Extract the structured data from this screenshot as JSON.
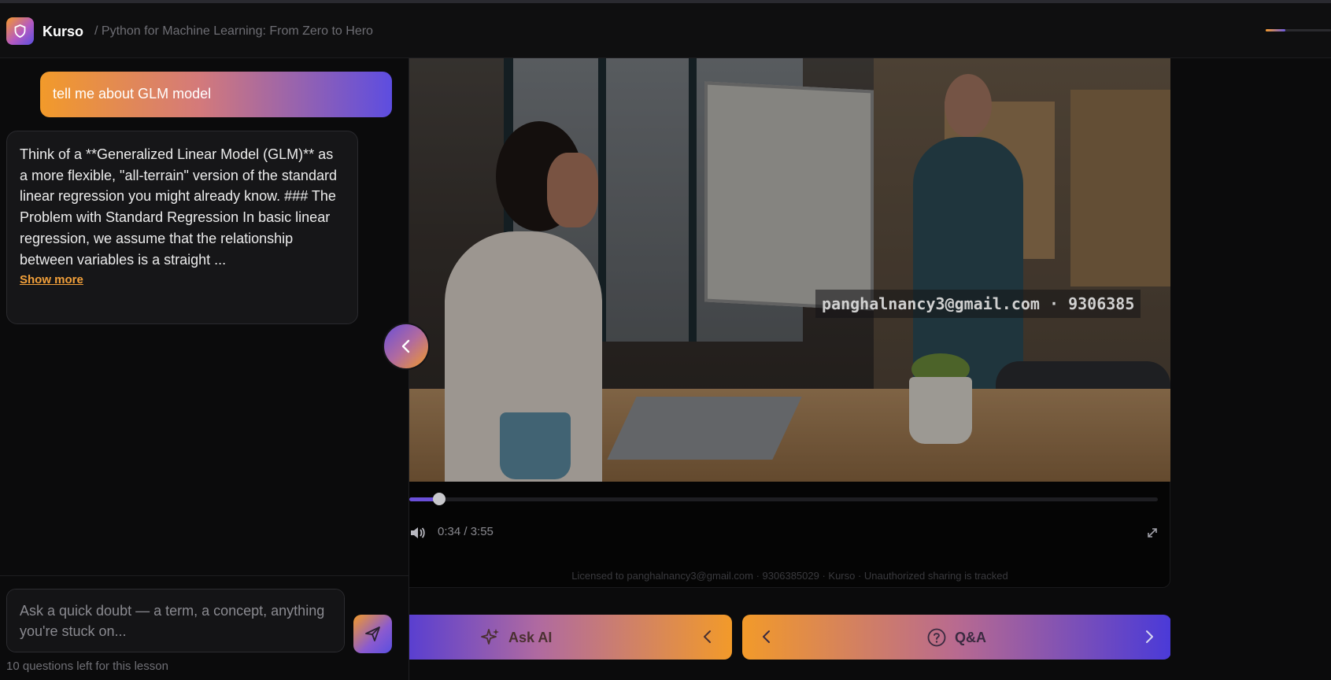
{
  "header": {
    "brand": "Kurso",
    "breadcrumb": "/ Python for Machine Learning: From Zero to Hero",
    "progress_fraction": 0.3
  },
  "chat": {
    "user_message": "tell me about GLM model",
    "ai_message": "Think of a **Generalized Linear Model (GLM)** as a more flexible, \"all-terrain\" version of the standard linear regression you might already know. ### The Problem with Standard Regression In basic linear regression, we assume that the relationship between variables is a straight ...",
    "show_more_label": "Show more",
    "input_placeholder": "Ask a quick doubt — a term, a concept, anything you're stuck on...",
    "questions_left": "10 questions left for this lesson"
  },
  "player": {
    "watermark": "panghalnancy3@gmail.com · 9306385",
    "time": "0:34 / 3:55",
    "progress_fraction": 0.04,
    "license": "Licensed to panghalnancy3@gmail.com · 9306385029 · Kurso · Unauthorized sharing is tracked"
  },
  "actions": {
    "ask_ai_label": "Ask AI",
    "qa_label": "Q&A"
  },
  "colors": {
    "accent_orange": "#f29a2a",
    "accent_purple": "#5d4de0",
    "background": "#0b0b0c"
  },
  "icons": [
    "shield-icon",
    "chevron-left-icon",
    "send-icon",
    "volume-icon",
    "fullscreen-icon",
    "sparkles-icon",
    "question-circle-icon",
    "chevron-right-icon"
  ]
}
